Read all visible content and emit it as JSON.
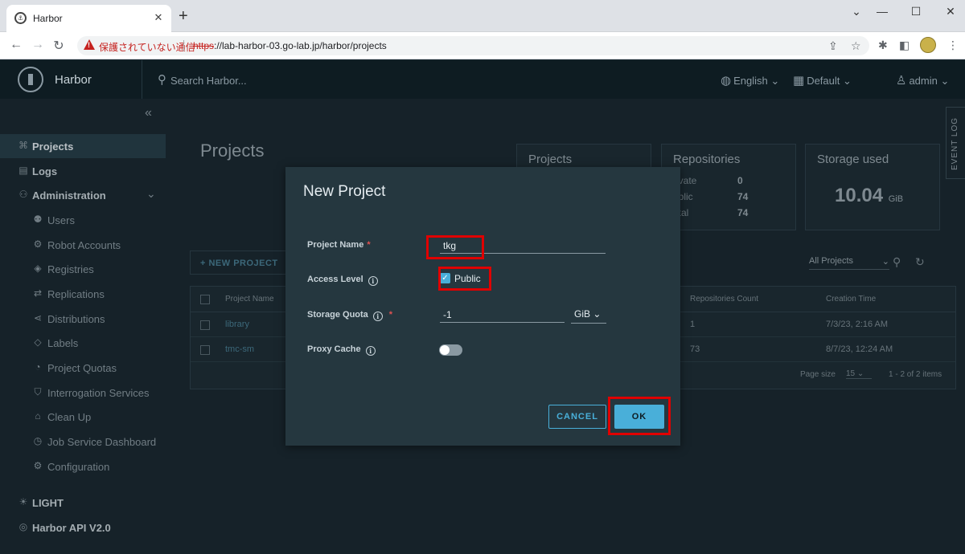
{
  "browser": {
    "tab_title": "Harbor",
    "new_tab": "+",
    "security_warning": "保護されていない通信",
    "url_scheme": "https",
    "url_rest": "://lab-harbor-03.go-lab.jp/harbor/projects"
  },
  "header": {
    "brand": "Harbor",
    "search_placeholder": "Search Harbor...",
    "language": "English",
    "theme_scope": "Default",
    "user": "admin"
  },
  "sidebar": {
    "items": [
      {
        "label": "Projects"
      },
      {
        "label": "Logs"
      },
      {
        "label": "Administration"
      }
    ],
    "admin_items": [
      {
        "label": "Users"
      },
      {
        "label": "Robot Accounts"
      },
      {
        "label": "Registries"
      },
      {
        "label": "Replications"
      },
      {
        "label": "Distributions"
      },
      {
        "label": "Labels"
      },
      {
        "label": "Project Quotas"
      },
      {
        "label": "Interrogation Services"
      },
      {
        "label": "Clean Up"
      },
      {
        "label": "Job Service Dashboard"
      },
      {
        "label": "Configuration"
      }
    ],
    "theme_toggle": "LIGHT",
    "api_link": "Harbor API V2.0"
  },
  "main": {
    "title": "Projects",
    "cards": {
      "projects_title": "Projects",
      "repos_title": "Repositories",
      "repos_private_label": "rivate",
      "repos_private": "0",
      "repos_public_label": "ublic",
      "repos_public": "74",
      "repos_total_label": "otal",
      "repos_total": "74",
      "storage_title": "Storage used",
      "storage_value": "10.04",
      "storage_unit": "GiB"
    },
    "new_project_button": "+ NEW PROJECT",
    "filter": "All Projects",
    "table": {
      "col_name": "Project Name",
      "col_repos": "Repositories Count",
      "col_created": "Creation Time",
      "rows": [
        {
          "name": "library",
          "repos": "1",
          "created": "7/3/23, 2:16 AM"
        },
        {
          "name": "tmc-sm",
          "repos": "73",
          "created": "8/7/23, 12:24 AM"
        }
      ],
      "page_size_label": "Page size",
      "page_size": "15",
      "range": "1 - 2 of 2 items"
    },
    "event_log": "EVENT LOG"
  },
  "modal": {
    "title": "New Project",
    "project_name_label": "Project Name",
    "project_name_value": "tkg",
    "access_level_label": "Access Level",
    "public_label": "Public",
    "storage_quota_label": "Storage Quota",
    "storage_quota_value": "-1",
    "storage_unit": "GiB",
    "proxy_cache_label": "Proxy Cache",
    "cancel": "CANCEL",
    "ok": "OK"
  },
  "colors": {
    "accent": "#49afd9",
    "highlight": "#e00000"
  }
}
